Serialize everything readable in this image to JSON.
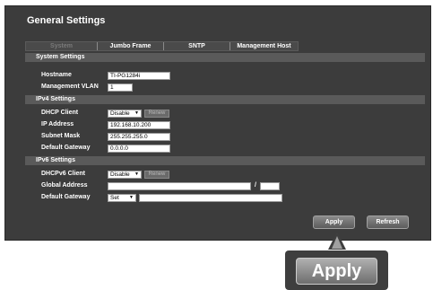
{
  "page": {
    "title": "General Settings"
  },
  "tabs": [
    {
      "label": "System",
      "active": true
    },
    {
      "label": "Jumbo Frame",
      "active": false
    },
    {
      "label": "SNTP",
      "active": false
    },
    {
      "label": "Management Host",
      "active": false
    }
  ],
  "system": {
    "section": "System Settings",
    "hostname_label": "Hostname",
    "hostname_value": "TI-PG1284i",
    "vlan_label": "Management VLAN",
    "vlan_value": "1"
  },
  "ipv4": {
    "section": "IPv4 Settings",
    "dhcp_label": "DHCP Client",
    "dhcp_value": "Disable",
    "renew_label": "Renew",
    "ip_label": "IP Address",
    "ip_value": "192.168.10.200",
    "mask_label": "Subnet Mask",
    "mask_value": "255.255.255.0",
    "gw_label": "Default Gateway",
    "gw_value": "0.0.0.0"
  },
  "ipv6": {
    "section": "IPv6 Settings",
    "dhcp_label": "DHCPv6 Client",
    "dhcp_value": "Disable",
    "renew_label": "Renew",
    "global_label": "Global Address",
    "global_value": "",
    "prefix_separator": "/",
    "prefix_value": "",
    "gw_label": "Default Gateway",
    "gw_mode": "Set",
    "gw_value": ""
  },
  "actions": {
    "apply_label": "Apply",
    "refresh_label": "Refresh"
  },
  "callout": {
    "label": "Apply"
  },
  "icons": {
    "dropdown": "chevron-down-icon"
  }
}
